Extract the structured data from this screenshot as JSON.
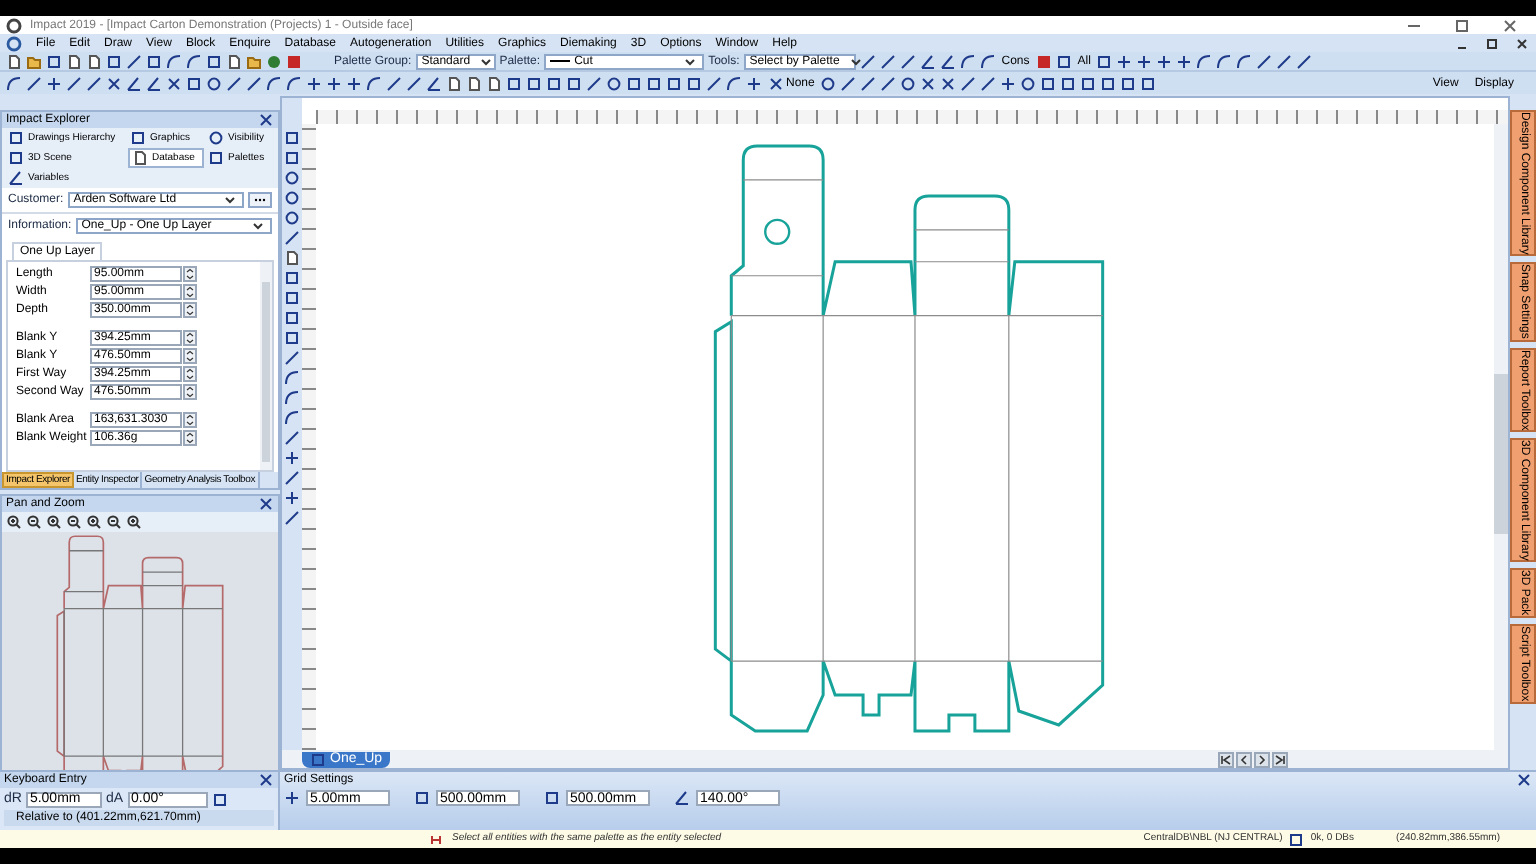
{
  "window": {
    "title": "Impact 2019 - [Impact Carton Demonstration (Projects) 1 - Outside face]"
  },
  "menu": [
    "File",
    "Edit",
    "Draw",
    "View",
    "Block",
    "Enquire",
    "Database",
    "Autogeneration",
    "Utilities",
    "Graphics",
    "Diemaking",
    "3D",
    "Options",
    "Window",
    "Help"
  ],
  "toolbar": {
    "palette_group_label": "Palette Group:",
    "palette_group": "Standard",
    "palette_label": "Palette:",
    "palette": "Cut",
    "tools_label": "Tools:",
    "tools": "Select by Palette",
    "cons_button": "Cons",
    "all_button": "All",
    "none_button": "None",
    "view_menu": "View",
    "display_menu": "Display"
  },
  "explorer": {
    "title": "Impact Explorer",
    "tabs": [
      {
        "label": "Drawings Hierarchy",
        "selected": false
      },
      {
        "label": "Graphics",
        "selected": false
      },
      {
        "label": "Visibility",
        "selected": false
      },
      {
        "label": "3D Scene",
        "selected": false
      },
      {
        "label": "Database",
        "selected": true
      },
      {
        "label": "Palettes",
        "selected": false
      },
      {
        "label": "Variables",
        "selected": false
      }
    ],
    "customer_label": "Customer:",
    "customer": "Arden Software Ltd",
    "information_label": "Information:",
    "information": "One_Up - One Up Layer",
    "group_tab": "One Up Layer",
    "fields": [
      {
        "label": "Length",
        "value": "95.00mm"
      },
      {
        "label": "Width",
        "value": "95.00mm"
      },
      {
        "label": "Depth",
        "value": "350.00mm"
      },
      {
        "label": "Blank Y",
        "value": "394.25mm"
      },
      {
        "label": "Blank Y",
        "value": "476.50mm"
      },
      {
        "label": "First Way",
        "value": "394.25mm"
      },
      {
        "label": "Second Way",
        "value": "476.50mm"
      },
      {
        "label": "Blank Area",
        "value": "163,631.3030"
      },
      {
        "label": "Blank Weight",
        "value": "106.36g"
      }
    ],
    "bottom_tabs": [
      {
        "label": "Impact Explorer",
        "selected": true
      },
      {
        "label": "Entity Inspector",
        "selected": false
      },
      {
        "label": "Geometry Analysis Toolbox",
        "selected": false
      }
    ]
  },
  "pan_zoom": {
    "title": "Pan and Zoom"
  },
  "canvas": {
    "layer_tab": "One_Up"
  },
  "right_tabs": [
    "Design Component Library",
    "Snap Settings",
    "Report Toolbox",
    "3D Component Library",
    "3D Pack",
    "Script Toolbox"
  ],
  "keyboard_entry": {
    "title": "Keyboard Entry",
    "dr_label": "dR",
    "dr": "5.00mm",
    "da_label": "dA",
    "da": "0.00°",
    "relative": "Relative to (401.22mm,621.70mm)"
  },
  "grid_settings": {
    "title": "Grid Settings",
    "values": [
      "5.00mm",
      "500.00mm",
      "500.00mm",
      "140.00°"
    ]
  },
  "status_bar": {
    "message": "Select all entities with the same palette as the entity selected",
    "database": "CentralDB\\NBL (NJ CENTRAL)",
    "dbs": "0k, 0 DBs",
    "coordinates": "(240.82mm,386.55mm)"
  }
}
